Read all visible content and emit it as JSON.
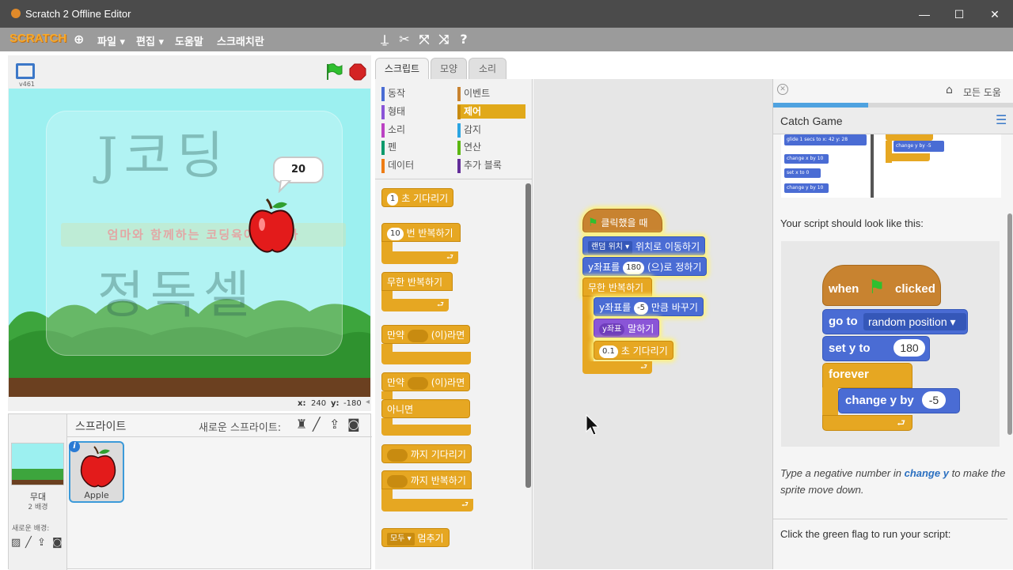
{
  "window": {
    "title": "Scratch 2 Offline Editor",
    "min": "—",
    "max": "☐",
    "close": "✕"
  },
  "menu": {
    "logo": "SCRATCH",
    "file": "파일 ▾",
    "edit": "편집 ▾",
    "help": "도움말",
    "about": "스크래치란"
  },
  "stage": {
    "version": "v461",
    "bubble_value": "20",
    "watermark_top": "J코딩",
    "watermark_banner": "엄마와 함께하는 코딩육아 전문가",
    "watermark_bottom": "정독셀",
    "x_label": "x:",
    "x_value": "240",
    "y_label": "y:",
    "y_value": "-180"
  },
  "sprites": {
    "header": "스프라이트",
    "new_sprite": "새로운 스프라이트:",
    "stage_label": "무대",
    "stage_sub": "2 배경",
    "new_backdrop": "새로운 배경:",
    "sprite_name": "Apple",
    "info": "i"
  },
  "tabs": {
    "scripts": "스크립트",
    "costumes": "모양",
    "sounds": "소리"
  },
  "categories": [
    {
      "label": "동작",
      "color": "#4a6cd4"
    },
    {
      "label": "형태",
      "color": "#8a55d7"
    },
    {
      "label": "소리",
      "color": "#bb42c3"
    },
    {
      "label": "펜",
      "color": "#0e9a6c"
    },
    {
      "label": "데이터",
      "color": "#ee7d16"
    },
    {
      "label": "이벤트",
      "color": "#c88330"
    },
    {
      "label": "제어",
      "color": "#e1a91a"
    },
    {
      "label": "감지",
      "color": "#2ca5e2"
    },
    {
      "label": "연산",
      "color": "#5cb712"
    },
    {
      "label": "추가 블록",
      "color": "#632d99"
    }
  ],
  "palette": {
    "wait_val": "1",
    "wait": "초 기다리기",
    "repeat_val": "10",
    "repeat": "번 반복하기",
    "forever": "무한 반복하기",
    "if_pre": "만약",
    "if_post": "(이)라면",
    "ifelse_pre": "만약",
    "ifelse_post": "(이)라면",
    "else": "아니면",
    "wait_until": "까지 기다리기",
    "repeat_until": "까지 반복하기",
    "stop_val": "모두",
    "stop": "멈추기"
  },
  "script": {
    "hat": "클릭했을 때",
    "goto_val": "랜덤 위치",
    "goto_suffix": "위치로 이동하기",
    "sety_pre": "y좌표를",
    "sety_val": "180",
    "sety_suffix": "(으)로 정하기",
    "forever": "무한 반복하기",
    "changey_pre": "y좌표를",
    "changey_val": "-5",
    "changey_suffix": "만큼 바꾸기",
    "say_val": "y좌표",
    "say_suffix": "말하기",
    "wait_val": "0.1",
    "wait_suffix": "초 기다리기"
  },
  "help": {
    "home": "모든 도움",
    "title": "Catch Game",
    "thumb_glide": "glide 1 secs to x: 42 y: 28",
    "thumb_changex": "change x by 10",
    "thumb_setx": "set x to 0",
    "thumb_changey": "change y by 10",
    "thumb_changey2": "change y by -5",
    "intro": "Your script should look like this:",
    "when": "when",
    "clicked": "clicked",
    "goto": "go to",
    "goto_val": "random position",
    "sety": "set y to",
    "sety_val": "180",
    "forever": "forever",
    "changey": "change y by",
    "changey_val": "-5",
    "tip_a": "Type a negative number in",
    "tip_link": "change y",
    "tip_b": "to make the sprite move down.",
    "run": "Click the green flag to run your script:"
  }
}
